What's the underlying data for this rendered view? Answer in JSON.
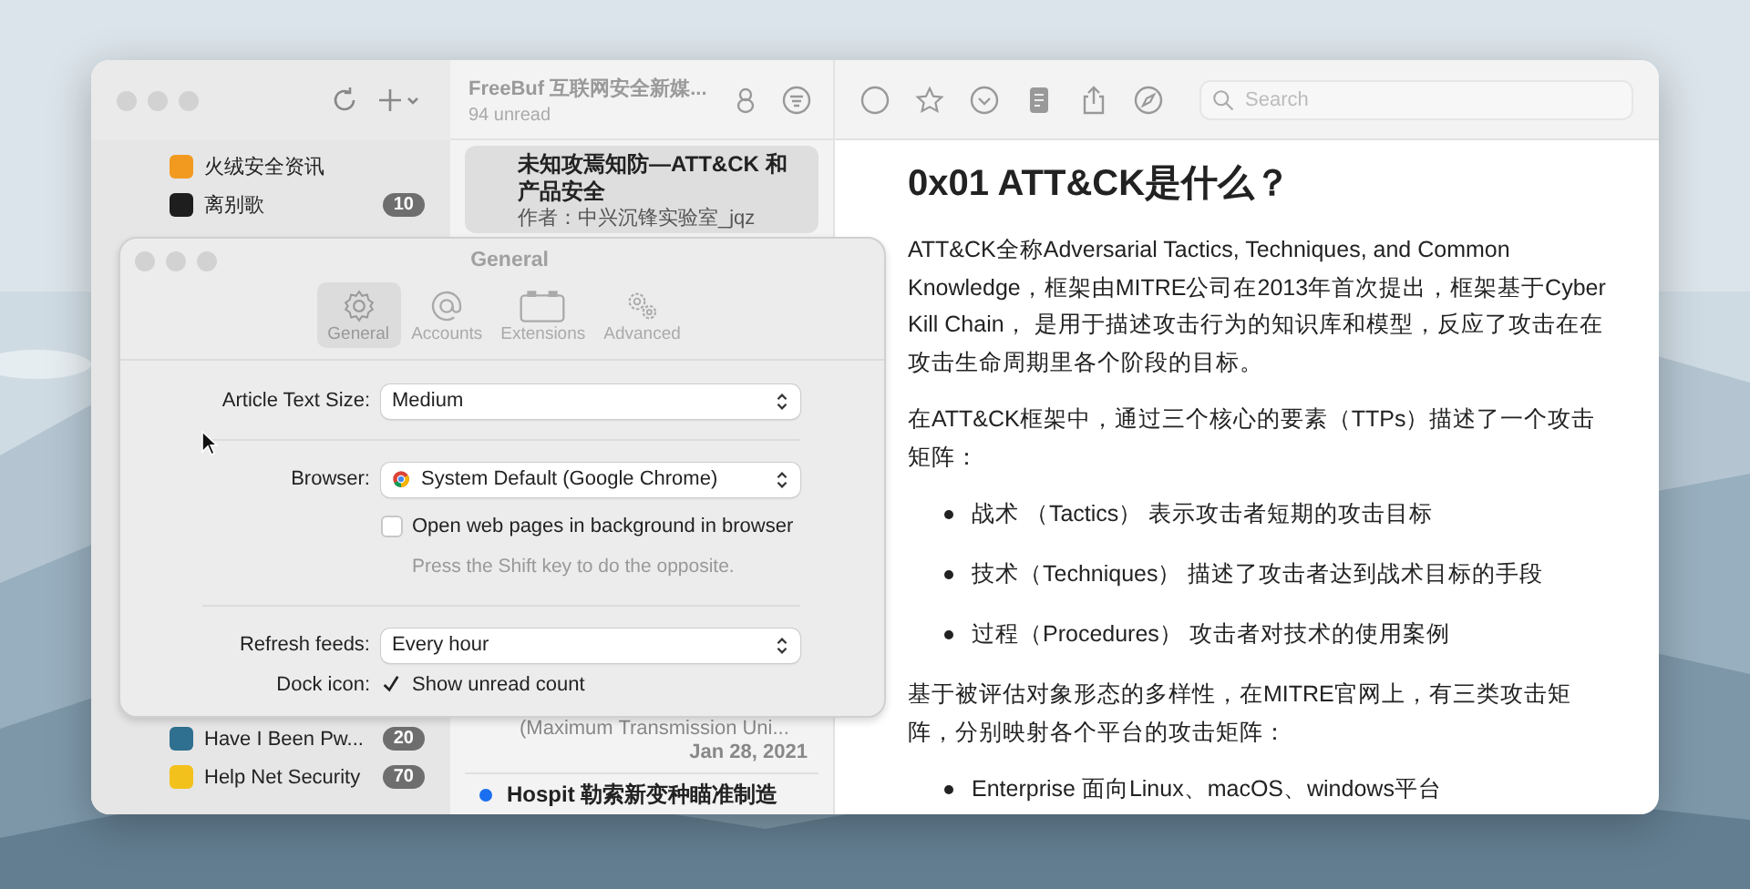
{
  "main_window": {
    "title": "FreeBuf 互联网安全新媒...",
    "subtitle": "94 unread",
    "search": {
      "placeholder": "Search"
    }
  },
  "sidebar": {
    "items_top": [
      {
        "name": "火绒安全资讯",
        "color": "#f29a1f"
      },
      {
        "name": "离别歌",
        "count": "10",
        "color": "#1e1e1e"
      }
    ],
    "items_bottom": [
      {
        "name": "Have I Been Pw...",
        "count": "20",
        "color": "#2f6f8f"
      },
      {
        "name": "Help Net Security",
        "count": "70",
        "color": "#f3c11b"
      }
    ]
  },
  "article_list": {
    "items": [
      {
        "kind": "card",
        "title": "未知攻焉知防—ATT&CK 和产品安全",
        "author": "作者：中兴沉锋实验室_jqz",
        "selected": true
      },
      {
        "kind": "tail",
        "summary": "(Maximum Transmission Uni...",
        "date": "Jan 28, 2021"
      },
      {
        "kind": "headline",
        "title": "Hospit 勒索新变种瞄准制造",
        "unread": true
      }
    ]
  },
  "article": {
    "heading": "0x01 ATT&CK是什么？",
    "blocks": [
      {
        "kind": "paragraph",
        "text": "ATT&CK全称Adversarial Tactics, Techniques, and Common Knowledge，框架由MITRE公司在2013年首次提出，框架基于Cyber Kill Chain， 是用于描述攻击行为的知识库和模型，反应了攻击在在攻击生命周期里各个阶段的目标。"
      },
      {
        "kind": "paragraph",
        "text": "在ATT&CK框架中，通过三个核心的要素（TTPs）描述了一个攻击矩阵："
      },
      {
        "kind": "bullets",
        "items": [
          "战术 （Tactics） 表示攻击者短期的攻击目标",
          "技术（Techniques） 描述了攻击者达到战术目标的手段",
          "过程（Procedures） 攻击者对技术的使用案例"
        ]
      },
      {
        "kind": "paragraph",
        "text": "基于被评估对象形态的多样性，在MITRE官网上，有三类攻击矩阵，分别映射各个平台的攻击矩阵："
      },
      {
        "kind": "bullets",
        "items": [
          "Enterprise 面向Linux、macOS、windows平台"
        ]
      }
    ]
  },
  "preferences": {
    "title": "General",
    "tabs": [
      {
        "label": "General",
        "selected": true
      },
      {
        "label": "Accounts",
        "selected": false
      },
      {
        "label": "Extensions",
        "selected": false
      },
      {
        "label": "Advanced",
        "selected": false
      }
    ],
    "rows": [
      {
        "kind": "popup",
        "label": "Article Text Size:",
        "value": "Medium"
      },
      {
        "kind": "divider"
      },
      {
        "kind": "browser-popup",
        "label": "Browser:",
        "value": "System Default (Google Chrome)"
      },
      {
        "kind": "checkbox",
        "text": "Open web pages in background in browser",
        "checked": false,
        "hint": "Press the Shift key to do the opposite."
      },
      {
        "kind": "divider"
      },
      {
        "kind": "popup",
        "label": "Refresh feeds:",
        "value": "Every hour"
      },
      {
        "kind": "checkmark",
        "label": "Dock icon:",
        "text": "Show unread count",
        "checked": true
      }
    ]
  }
}
